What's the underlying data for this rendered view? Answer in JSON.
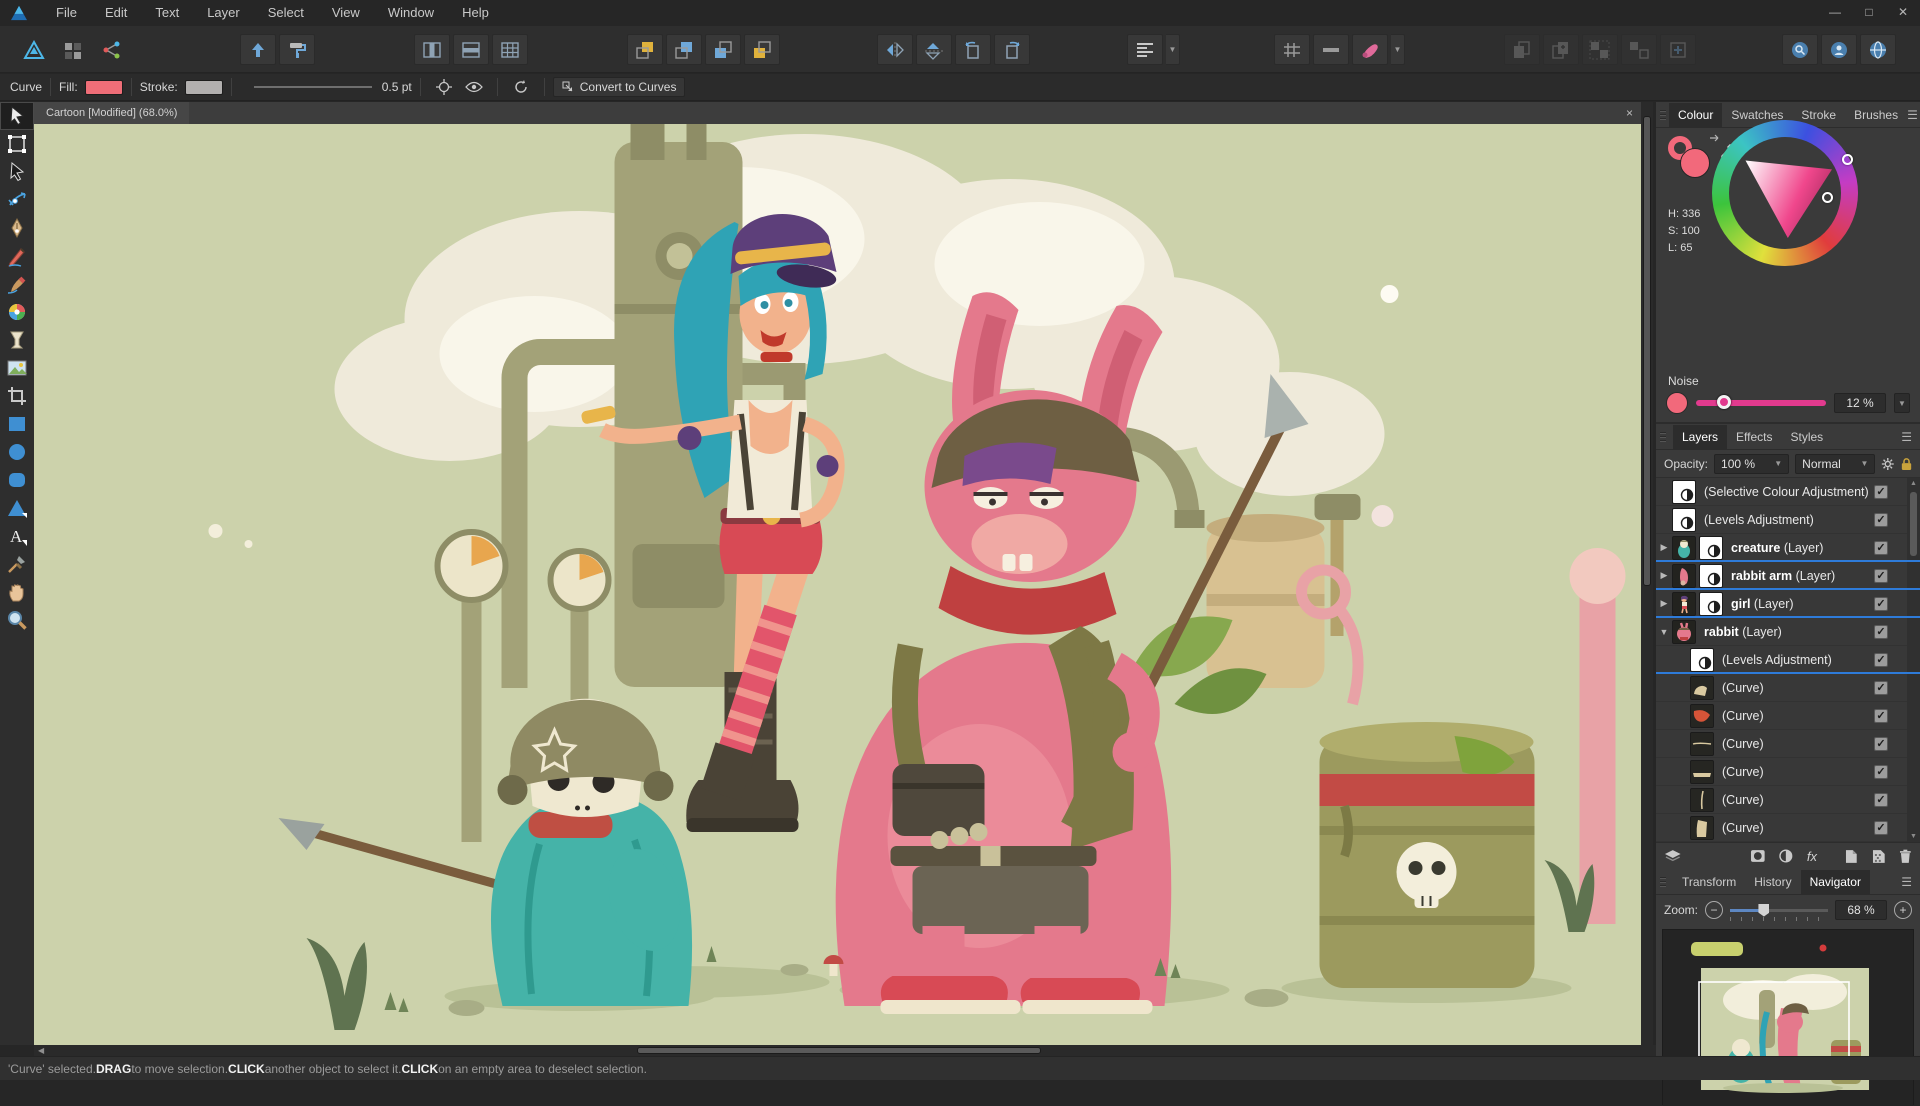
{
  "titlebar": {
    "menus": [
      "File",
      "Edit",
      "Text",
      "Layer",
      "Select",
      "View",
      "Window",
      "Help"
    ],
    "window_controls": [
      "minimize",
      "maximize",
      "close"
    ]
  },
  "toolbar": {
    "groups": [
      {
        "name": "personas",
        "icons": [
          "persona-designer-icon",
          "persona-pixel-icon",
          "persona-export-icon"
        ]
      },
      {
        "name": "snapping-pair",
        "icons": [
          "arrow-up-icon",
          "paint-roller-icon"
        ]
      },
      {
        "name": "tables",
        "icons": [
          "table-columns-icon",
          "table-rows-icon",
          "table-cells-icon"
        ]
      },
      {
        "name": "arrange",
        "icons": [
          "move-to-front-icon",
          "move-forward-icon",
          "move-backward-icon",
          "move-to-back-icon"
        ]
      },
      {
        "name": "transform",
        "icons": [
          "flip-horizontal-icon",
          "flip-vertical-icon",
          "rotate-ccw-icon",
          "rotate-cw-icon"
        ]
      },
      {
        "name": "alignment",
        "icons": [
          "alignment-icon"
        ],
        "dropdown": true
      },
      {
        "name": "snapping",
        "icons": [
          "grid-icon",
          "divider-icon",
          "assistant-brush-icon"
        ],
        "dropdown": true
      },
      {
        "name": "clipboard-disabled",
        "icons": [
          "duplicate-icon",
          "clone-icon",
          "group-icon",
          "ungroup-icon",
          "insert-icon"
        ],
        "disabled": true
      },
      {
        "name": "view-circles",
        "icons": [
          "search-circle-icon",
          "person-circle-icon",
          "globe-circle-icon"
        ]
      }
    ]
  },
  "context_toolbar": {
    "object_type": "Curve",
    "fill_label": "Fill:",
    "fill_color": "#ef6e78",
    "stroke_label": "Stroke:",
    "stroke_color": "#b2b0af",
    "stroke_width": "0.5 pt",
    "icons": [
      "transform-origin-icon",
      "eye-icon",
      "rotate-icon"
    ],
    "convert_button": "Convert to Curves"
  },
  "document": {
    "tab_title": "Cartoon [Modified] (68.0%)",
    "close_glyph": "×"
  },
  "tools": {
    "active": "move-tool",
    "items": [
      "move-tool",
      "artboard-tool",
      "node-tool",
      "point-transform-tool",
      "pen-tool",
      "pencil-tool",
      "vector-brush-tool",
      "colour-wheel-tool",
      "transparency-tool",
      "place-image-tool",
      "crop-tool",
      "rectangle-tool",
      "ellipse-tool",
      "rounded-rectangle-tool",
      "triangle-tool",
      "text-tool",
      "colour-picker-tool",
      "hand-tool",
      "zoom-tool"
    ]
  },
  "colour_panel": {
    "tabs": [
      "Colour",
      "Swatches",
      "Stroke",
      "Brushes"
    ],
    "active_tab": "Colour",
    "h_label": "H: 336",
    "s_label": "S: 100",
    "l_label": "L: 65",
    "noise_label": "Noise",
    "noise_value": "12 %",
    "fill_swatch_color": "#f2697b",
    "noise_slider_color": "#e23a8e"
  },
  "layers_panel": {
    "tabs": [
      "Layers",
      "Effects",
      "Styles"
    ],
    "active_tab": "Layers",
    "opacity_label": "Opacity:",
    "opacity_value": "100 %",
    "blend_mode": "Normal",
    "rows": [
      {
        "thumbs": [
          "adjustment"
        ],
        "bold": "",
        "rest": "(Selective Colour Adjustment)",
        "expander": "none",
        "indent": 0,
        "underline": false,
        "checked": true
      },
      {
        "thumbs": [
          "adjustment"
        ],
        "bold": "",
        "rest": "(Levels Adjustment)",
        "expander": "none",
        "indent": 0,
        "underline": false,
        "checked": true
      },
      {
        "thumbs": [
          "art-creature",
          "adjustment"
        ],
        "bold": "creature",
        "rest": " (Layer)",
        "expander": "collapsed",
        "indent": 0,
        "underline": true,
        "checked": true
      },
      {
        "thumbs": [
          "art-rabbit-arm",
          "adjustment"
        ],
        "bold": "rabbit arm",
        "rest": " (Layer)",
        "expander": "collapsed",
        "indent": 0,
        "underline": true,
        "checked": true
      },
      {
        "thumbs": [
          "art-girl",
          "adjustment"
        ],
        "bold": "girl",
        "rest": " (Layer)",
        "expander": "collapsed",
        "indent": 0,
        "underline": true,
        "checked": true
      },
      {
        "thumbs": [
          "art-rabbit"
        ],
        "bold": "rabbit",
        "rest": " (Layer)",
        "expander": "expanded",
        "indent": 0,
        "underline": false,
        "checked": true
      },
      {
        "thumbs": [
          "adjustment"
        ],
        "bold": "",
        "rest": "(Levels Adjustment)",
        "expander": "none",
        "indent": 1,
        "underline": true,
        "checked": true
      },
      {
        "thumbs": [
          "curve-arch"
        ],
        "bold": "",
        "rest": "(Curve)",
        "expander": "none",
        "indent": 1,
        "underline": false,
        "checked": true
      },
      {
        "thumbs": [
          "curve-red-blob"
        ],
        "bold": "",
        "rest": "(Curve)",
        "expander": "none",
        "indent": 1,
        "underline": false,
        "checked": true
      },
      {
        "thumbs": [
          "curve-thin-line"
        ],
        "bold": "",
        "rest": "(Curve)",
        "expander": "none",
        "indent": 1,
        "underline": false,
        "checked": true
      },
      {
        "thumbs": [
          "curve-strip"
        ],
        "bold": "",
        "rest": "(Curve)",
        "expander": "none",
        "indent": 1,
        "underline": false,
        "checked": true
      },
      {
        "thumbs": [
          "curve-vline"
        ],
        "bold": "",
        "rest": "(Curve)",
        "expander": "none",
        "indent": 1,
        "underline": false,
        "checked": true
      },
      {
        "thumbs": [
          "curve-block"
        ],
        "bold": "",
        "rest": "(Curve)",
        "expander": "none",
        "indent": 1,
        "underline": false,
        "checked": true
      }
    ],
    "footer_icons": [
      "layers-stack-icon",
      "mask-icon",
      "adjustment-icon",
      "fx-icon",
      "new-layer-icon",
      "new-pattern-layer-icon",
      "trash-icon"
    ]
  },
  "navigator_panel": {
    "tabs": [
      "Transform",
      "History",
      "Navigator"
    ],
    "active_tab": "Navigator",
    "zoom_label": "Zoom:",
    "zoom_value": "68 %"
  },
  "status_bar": {
    "segments": [
      {
        "text": "'Curve' selected. ",
        "bold": false
      },
      {
        "text": "DRAG",
        "bold": true
      },
      {
        "text": " to move selection. ",
        "bold": false
      },
      {
        "text": "CLICK",
        "bold": true
      },
      {
        "text": " another object to select it. ",
        "bold": false
      },
      {
        "text": "CLICK",
        "bold": true
      },
      {
        "text": " on an empty area to deselect selection.",
        "bold": false
      }
    ]
  },
  "canvas": {
    "background_color": "#ccd2ab"
  }
}
